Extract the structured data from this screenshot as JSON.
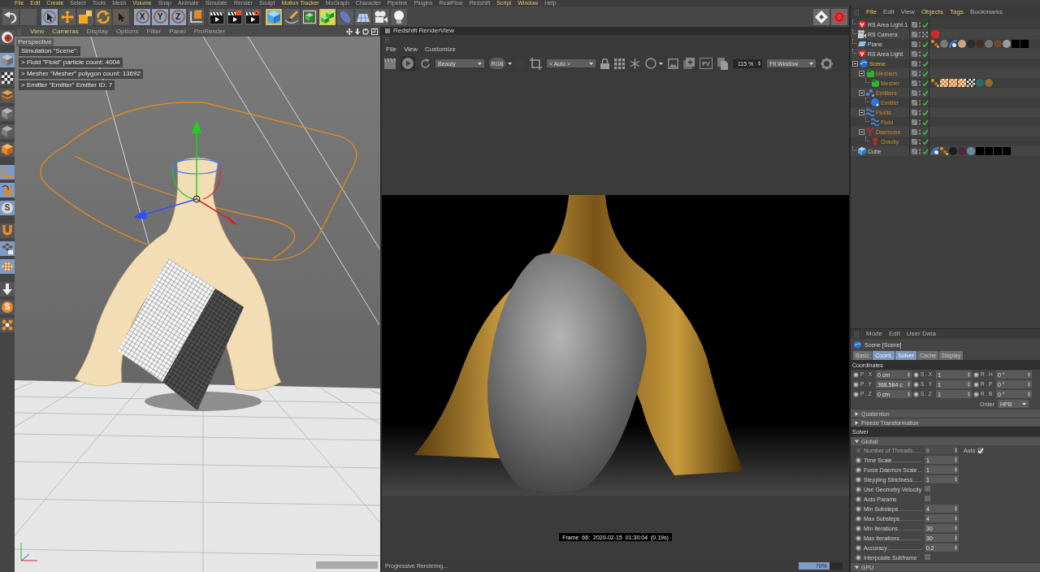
{
  "menu_bar": [
    {
      "label": "File",
      "highlighted": true
    },
    {
      "label": "Edit",
      "highlighted": true
    },
    {
      "label": "Create",
      "highlighted": true
    },
    {
      "label": "Select",
      "highlighted": false
    },
    {
      "label": "Tools",
      "highlighted": false
    },
    {
      "label": "Mesh",
      "highlighted": false
    },
    {
      "label": "Volume",
      "highlighted": true
    },
    {
      "label": "Snap",
      "highlighted": false
    },
    {
      "label": "Animate",
      "highlighted": false
    },
    {
      "label": "Simulate",
      "highlighted": false
    },
    {
      "label": "Render",
      "highlighted": false
    },
    {
      "label": "Sculpt",
      "highlighted": false
    },
    {
      "label": "Motion Tracker",
      "highlighted": true
    },
    {
      "label": "MoGraph",
      "highlighted": false
    },
    {
      "label": "Character",
      "highlighted": false
    },
    {
      "label": "Pipeline",
      "highlighted": false
    },
    {
      "label": "Plugins",
      "highlighted": false
    },
    {
      "label": "RealFlow",
      "highlighted": false
    },
    {
      "label": "Redshift",
      "highlighted": false
    },
    {
      "label": "Script",
      "highlighted": true
    },
    {
      "label": "Window",
      "highlighted": true
    },
    {
      "label": "Help",
      "highlighted": false
    }
  ],
  "toolbar": {
    "groups": [
      [
        {
          "kind": "undo",
          "selected": false,
          "highlighted": false
        },
        {
          "kind": "blank",
          "selected": false,
          "highlighted": false
        }
      ],
      [
        {
          "kind": "live-select",
          "selected": true,
          "highlighted": false
        },
        {
          "kind": "move",
          "selected": false,
          "highlighted": false
        },
        {
          "kind": "scale",
          "selected": false,
          "highlighted": false
        },
        {
          "kind": "rotate",
          "selected": false,
          "highlighted": false
        },
        {
          "kind": "select",
          "selected": false,
          "highlighted": false
        }
      ],
      [
        {
          "kind": "axis",
          "label": "X",
          "selected": true,
          "highlighted": false
        },
        {
          "kind": "axis",
          "label": "Y",
          "selected": true,
          "highlighted": false
        },
        {
          "kind": "axis",
          "label": "Z",
          "selected": true,
          "highlighted": false
        },
        {
          "kind": "coords",
          "selected": false,
          "highlighted": false
        }
      ],
      [
        {
          "kind": "render-view",
          "selected": false,
          "highlighted": false
        },
        {
          "kind": "render-pv",
          "selected": false,
          "highlighted": false
        },
        {
          "kind": "render-settings",
          "selected": false,
          "highlighted": false
        }
      ],
      [
        {
          "kind": "cube",
          "selected": true,
          "highlighted": true
        },
        {
          "kind": "pen",
          "selected": false,
          "highlighted": false
        },
        {
          "kind": "subdivision",
          "selected": false,
          "highlighted": false
        },
        {
          "kind": "cloner",
          "selected": false,
          "highlighted": true
        },
        {
          "kind": "deformer",
          "selected": false,
          "highlighted": false
        },
        {
          "kind": "floor",
          "selected": false,
          "highlighted": false
        },
        {
          "kind": "camera",
          "selected": false,
          "highlighted": false
        },
        {
          "kind": "light",
          "selected": false,
          "highlighted": false
        }
      ]
    ],
    "right": [
      {
        "kind": "diamond"
      },
      {
        "kind": "rs"
      }
    ]
  },
  "palette": {
    "groups": [
      [
        {
          "kind": "ball",
          "selected": false
        }
      ],
      [
        {
          "kind": "model",
          "selected": true
        },
        {
          "kind": "texture",
          "selected": false
        },
        {
          "kind": "layers",
          "selected": false
        },
        {
          "kind": "points",
          "selected": false
        },
        {
          "kind": "edges",
          "selected": false
        },
        {
          "kind": "polygons",
          "selected": false
        }
      ],
      [
        {
          "kind": "axis",
          "selected": true
        },
        {
          "kind": "tweak",
          "selected": true
        },
        {
          "kind": "snap",
          "label": "S",
          "selected": true
        }
      ],
      [
        {
          "kind": "magnet",
          "selected": false
        },
        {
          "kind": "grid",
          "selected": true
        },
        {
          "kind": "checker",
          "selected": true
        }
      ],
      [
        {
          "kind": "arrow",
          "selected": false
        },
        {
          "kind": "script",
          "label": "S",
          "selected": false
        },
        {
          "kind": "dots",
          "selected": false
        }
      ]
    ]
  },
  "viewport": {
    "menu": [
      {
        "label": "View",
        "highlighted": true
      },
      {
        "label": "Cameras",
        "highlighted": true
      },
      {
        "label": "Display",
        "highlighted": false
      },
      {
        "label": "Options",
        "highlighted": false
      },
      {
        "label": "Filter",
        "highlighted": false
      },
      {
        "label": "Panel",
        "highlighted": false
      },
      {
        "label": "ProRender",
        "highlighted": false
      }
    ],
    "camera": "Perspective",
    "info": [
      "Simulation \"Scene\":",
      "> Fluid \"Fluid\" particle count: 4004",
      "> Mesher \"Mesher\" polygon count: 13692",
      "> Emitter \"Emitter\" Emitter ID: 7"
    ]
  },
  "render_view": {
    "title": "Redshift RenderView",
    "menu": [
      "File",
      "View",
      "Customize"
    ],
    "running": true,
    "aov": "Beauty",
    "channel": "RGB",
    "region": "< Auto >",
    "snapshot_label": "PV",
    "zoom": "115 %",
    "fit": "Fit Window",
    "frame_info": "Frame 66: 2020-02-15 01:30:04 (0.19s)",
    "status": "Progressive Rendering...",
    "progress": {
      "level": 0.7,
      "text": "70%"
    }
  },
  "object_manager": {
    "menu": [
      {
        "label": "File",
        "highlighted": true
      },
      {
        "label": "Edit",
        "highlighted": false
      },
      {
        "label": "View",
        "highlighted": false
      },
      {
        "label": "Objects",
        "highlighted": true
      },
      {
        "label": "Tags",
        "highlighted": true
      },
      {
        "label": "Bookmarks",
        "highlighted": false
      }
    ],
    "objects": [
      {
        "name": "RS Area Light.1",
        "kind": "rs-light",
        "selected": false,
        "enabled": true
      },
      {
        "name": "RS Camera",
        "kind": "camera",
        "selected": false,
        "enabled": false,
        "tags": [
          {
            "kind": "rs-tag"
          }
        ]
      },
      {
        "name": "Plane",
        "kind": "plane",
        "selected": false,
        "enabled": true,
        "tags": [
          {
            "kind": "uvw"
          },
          {
            "kind": "material",
            "color": "#7a7a78"
          },
          {
            "kind": "phong"
          },
          {
            "kind": "material",
            "color": "#c9a57c"
          },
          {
            "kind": "material",
            "color": "#2b2b2b"
          },
          {
            "kind": "material",
            "color": "#3d3024"
          },
          {
            "kind": "material",
            "color": "#747474"
          },
          {
            "kind": "material",
            "color": "#6b4b2c"
          },
          {
            "kind": "material",
            "color": "#9c9c9c"
          },
          {
            "kind": "swatch",
            "color": "#000000"
          },
          {
            "kind": "swatch",
            "color": "#000000"
          }
        ]
      },
      {
        "name": "RS Area Light",
        "kind": "rs-light",
        "selected": false,
        "enabled": true
      },
      {
        "name": "Scene",
        "kind": "scene",
        "selected": true,
        "expanded": true,
        "enabled": true,
        "children": [
          {
            "name": "Meshers",
            "kind": "meshers",
            "selected": true,
            "expanded": true,
            "enabled": true,
            "children": [
              {
                "name": "Mesher",
                "kind": "mesher",
                "selected": true,
                "enabled": true,
                "tags": [
                  {
                    "kind": "uvw"
                  },
                  {
                    "kind": "checker"
                  },
                  {
                    "kind": "checker"
                  },
                  {
                    "kind": "checker"
                  },
                  {
                    "kind": "checker-bw"
                  },
                  {
                    "kind": "material",
                    "color": "#2c6b6b"
                  },
                  {
                    "kind": "material",
                    "color": "#8c6a2a"
                  }
                ]
              }
            ]
          },
          {
            "name": "Emitters",
            "kind": "emitters",
            "selected": true,
            "expanded": true,
            "enabled": true,
            "children": [
              {
                "name": "Emitter",
                "kind": "emitter",
                "selected": true,
                "enabled": true
              }
            ]
          },
          {
            "name": "Fluids",
            "kind": "fluids",
            "selected": true,
            "expanded": true,
            "enabled": true,
            "children": [
              {
                "name": "Fluid",
                "kind": "fluid",
                "selected": true,
                "enabled": true
              }
            ]
          },
          {
            "name": "Daemons",
            "kind": "daemons",
            "selected": true,
            "expanded": true,
            "enabled": true,
            "children": [
              {
                "name": "Gravity",
                "kind": "gravity",
                "selected": true,
                "enabled": true
              }
            ]
          }
        ]
      },
      {
        "name": "Cube",
        "kind": "cube",
        "selected": false,
        "enabled": true,
        "tags": [
          {
            "kind": "phong"
          },
          {
            "kind": "uvw"
          },
          {
            "kind": "material",
            "color": "#1c1c1c"
          },
          {
            "kind": "material",
            "color": "#4b2a3b"
          },
          {
            "kind": "material",
            "color": "#6b8b9b"
          },
          {
            "kind": "swatch",
            "color": "#000000"
          },
          {
            "kind": "swatch",
            "color": "#000000"
          },
          {
            "kind": "swatch",
            "color": "#000000"
          },
          {
            "kind": "swatch",
            "color": "#000000"
          }
        ]
      }
    ]
  },
  "attribute_manager": {
    "menu": [
      "Mode",
      "Edit",
      "User Data"
    ],
    "object": "Scene [Scene]",
    "tabs": [
      {
        "label": "Basic",
        "selected": false
      },
      {
        "label": "Coord.",
        "selected": true
      },
      {
        "label": "Solver",
        "selected": true
      },
      {
        "label": "Cache",
        "selected": false
      },
      {
        "label": "Display",
        "selected": false
      }
    ],
    "coordinates": {
      "title": "Coordinates",
      "rows": [
        [
          {
            "label": "P . X",
            "value": "0 cm"
          },
          {
            "label": "S . X",
            "value": "1"
          },
          {
            "label": "R . H",
            "value": "0 °"
          }
        ],
        [
          {
            "label": "P . Y",
            "value": "368.584 c"
          },
          {
            "label": "S . Y",
            "value": "1"
          },
          {
            "label": "R . P",
            "value": "0 °"
          }
        ],
        [
          {
            "label": "P . Z",
            "value": "0 cm"
          },
          {
            "label": "S . Z",
            "value": "1"
          },
          {
            "label": "R . B",
            "value": "0 °"
          }
        ]
      ],
      "order_label": "Order",
      "order": "HPB"
    },
    "folds": [
      {
        "label": "Quaternion",
        "expanded": false
      },
      {
        "label": "Freeze Transformation",
        "expanded": false
      }
    ],
    "solver": {
      "title": "Solver",
      "group": {
        "label": "Global",
        "expanded": true
      },
      "params": [
        {
          "kind": "number",
          "label": "Number of Threads",
          "value": "8",
          "disabled": true,
          "auto": {
            "label": "Auto",
            "checked": true
          }
        },
        {
          "kind": "number",
          "label": "Time Scale",
          "value": "1",
          "disabled": false
        },
        {
          "kind": "number",
          "label": "Force Daemon Scale",
          "value": "1",
          "disabled": false
        },
        {
          "kind": "number",
          "label": "Stepping Strictness",
          "value": "1",
          "disabled": false
        },
        {
          "kind": "checkbox",
          "label": "Use Geometry Velocity",
          "checked": false,
          "disabled": false
        },
        {
          "kind": "checkbox",
          "label": "Auto Params",
          "checked": false,
          "disabled": false
        },
        {
          "kind": "number",
          "label": "Min Substeps",
          "value": "4",
          "disabled": false
        },
        {
          "kind": "number",
          "label": "Max Substeps",
          "value": "4",
          "disabled": false
        },
        {
          "kind": "number",
          "label": "Min Iterations",
          "value": "30",
          "disabled": false
        },
        {
          "kind": "number",
          "label": "Max Iterations",
          "value": "30",
          "disabled": false
        },
        {
          "kind": "number",
          "label": "Accuracy",
          "value": "0.2",
          "disabled": false
        },
        {
          "kind": "checkbox",
          "label": "Interpolate Subframe",
          "checked": false,
          "disabled": false
        }
      ]
    },
    "gpu": {
      "label": "GPU",
      "expanded": true
    }
  }
}
